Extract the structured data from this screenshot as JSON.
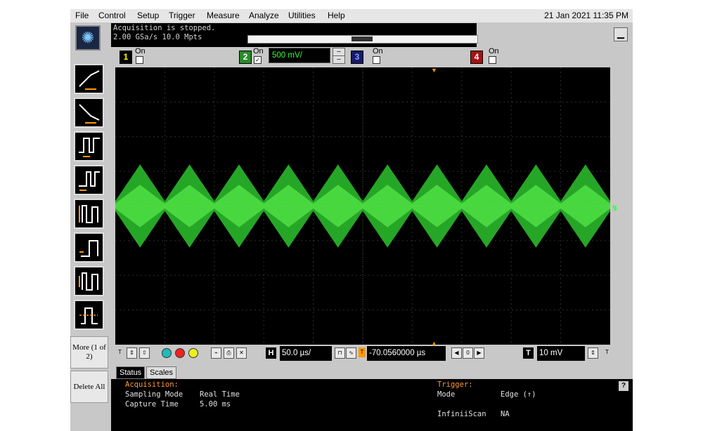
{
  "menu": {
    "items": [
      "File",
      "Control",
      "Setup",
      "Trigger",
      "Measure",
      "Analyze",
      "Utilities",
      "Help"
    ],
    "datetime": "21 Jan 2021 11:35 PM"
  },
  "acquisition_banner": {
    "line1": "Acquisition is stopped.",
    "line2": "2.00 GSa/s  10.0 Mpts"
  },
  "channels": [
    {
      "number": "1",
      "state": "On",
      "checked": false,
      "color": "#ffff00"
    },
    {
      "number": "2",
      "state": "On",
      "checked": true,
      "color": "#33cc33",
      "scale": "500 mV/"
    },
    {
      "number": "3",
      "state": "On",
      "checked": false,
      "color": "#3355ff"
    },
    {
      "number": "4",
      "state": "On",
      "checked": false,
      "color": "#ff2222"
    }
  ],
  "sidebar": {
    "more_label": "More (1 of 2)",
    "delete_label": "Delete All"
  },
  "horizontal": {
    "label": "H",
    "scale": "50.0 µs/",
    "position": "-70.0560000 µs"
  },
  "trigger": {
    "label": "T",
    "level": "10 mV"
  },
  "tabs": [
    {
      "label": "Status",
      "active": true
    },
    {
      "label": "Scales",
      "active": false
    }
  ],
  "status": {
    "acquisition_heading": "Acquisition:",
    "sampling_mode_label": "Sampling Mode",
    "sampling_mode_value": "Real Time",
    "capture_time_label": "Capture Time",
    "capture_time_value": "5.00 ms",
    "trigger_heading": "Trigger:",
    "mode_label": "Mode",
    "mode_value": "Edge (↑)",
    "infiniiscan_label": "InfiniiScan",
    "infiniiscan_value": "NA",
    "help_label": "?"
  },
  "waveform": {
    "channel": "2",
    "color": "#33dd33",
    "envelope_periods": 10,
    "amplitude_divisions": 1.2
  },
  "colors": {
    "graticule": "#2e2e2e",
    "trace": "#33dd33",
    "trigger_marker": "#ff9900"
  }
}
